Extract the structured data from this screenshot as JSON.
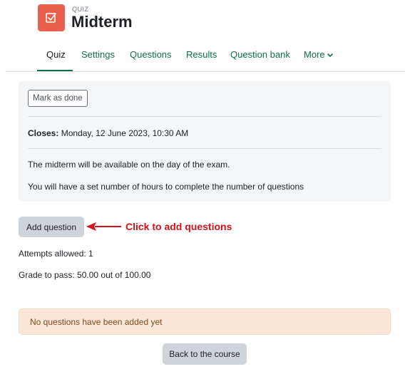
{
  "header": {
    "pretitle": "QUIZ",
    "title": "Midterm",
    "icon": "quiz-checkbox-icon",
    "icon_color": "#e8604c"
  },
  "nav": {
    "tabs": [
      {
        "label": "Quiz",
        "active": true
      },
      {
        "label": "Settings",
        "active": false
      },
      {
        "label": "Questions",
        "active": false
      },
      {
        "label": "Results",
        "active": false
      },
      {
        "label": "Question bank",
        "active": false
      },
      {
        "label": "More",
        "active": false
      }
    ],
    "accent": "#0f6e4d"
  },
  "info": {
    "mark_done_label": "Mark as done",
    "closes_label": "Closes:",
    "closes_value": " Monday, 12 June 2023, 10:30 AM",
    "description": [
      "The midterm will be available on the day of the exam.",
      "You will have a set number of hours to complete the number of questions"
    ]
  },
  "actions": {
    "add_question_label": "Add question",
    "annotation": "Click to add questions",
    "annotation_color": "#d6111a"
  },
  "stats": {
    "attempts": "Attempts allowed: 1",
    "grade": "Grade to pass: 50.00 out of 100.00"
  },
  "notice": "No questions have been added yet",
  "footer": {
    "back_label": "Back to the course"
  }
}
